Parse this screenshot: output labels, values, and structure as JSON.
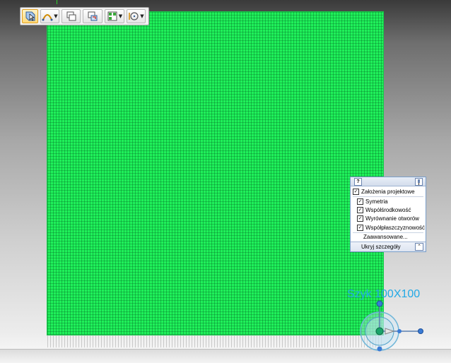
{
  "toolbar": {
    "buttons": [
      {
        "icon": "select-face-icon",
        "active": true
      },
      {
        "icon": "arc-sketch-icon",
        "dropdown": true
      },
      {
        "icon": "copy-faces-icon"
      },
      {
        "icon": "move-copy-icon"
      },
      {
        "icon": "pattern-icon",
        "dropdown": true
      },
      {
        "icon": "rotate-icon",
        "dropdown": true
      }
    ]
  },
  "panel": {
    "help": "?",
    "main_option": {
      "label": "Założenia projektowe",
      "checked": true
    },
    "options": [
      {
        "label": "Symetria",
        "checked": true
      },
      {
        "label": "Współśrodkowość",
        "checked": true
      },
      {
        "label": "Wyrównanie otworów",
        "checked": true
      },
      {
        "label": "Współpłaszczyznowość",
        "checked": true
      }
    ],
    "advanced": "Zaawansowane...",
    "footer": "Ukryj szczegóły"
  },
  "dimension_label": "Szyk 100X100",
  "colors": {
    "mesh": "#1ff05a",
    "label": "#22a9e6",
    "panel_border": "#7a9ec9"
  }
}
